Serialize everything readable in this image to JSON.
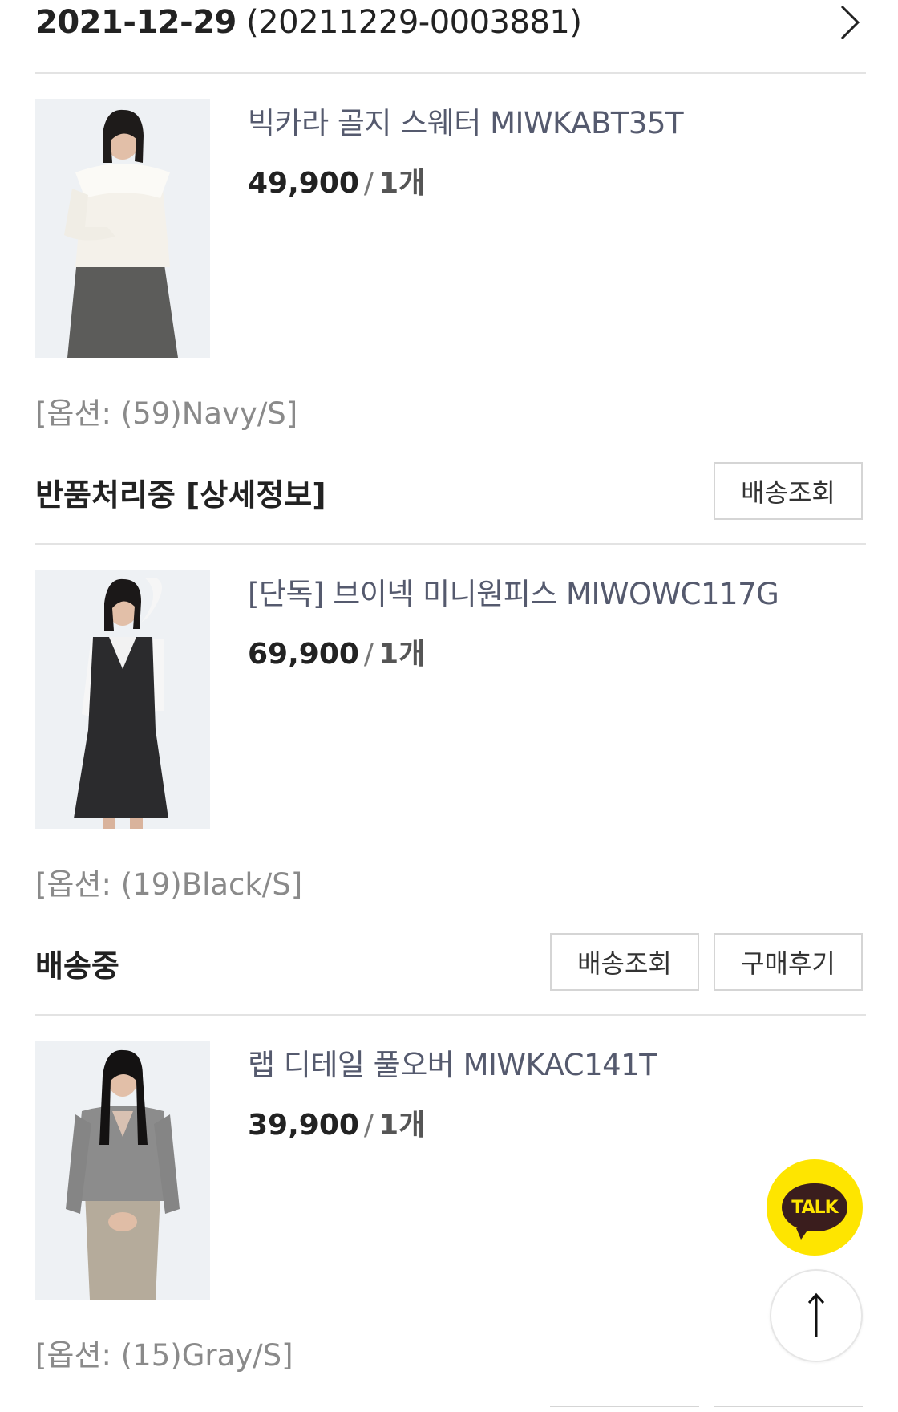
{
  "order": {
    "date": "2021-12-29",
    "number": "(20211229-0003881)"
  },
  "items": [
    {
      "name": "빅카라 골지 스웨터 MIWKABT35T",
      "price": "49,900",
      "separator": "/",
      "quantity": "1개",
      "option": "[옵션: (59)Navy/S]",
      "status": "반품처리중 [상세정보]",
      "buttons": [
        "배송조회"
      ]
    },
    {
      "name": "[단독] 브이넥 미니원피스 MIWOWC117G",
      "price": "69,900",
      "separator": "/",
      "quantity": "1개",
      "option": "[옵션: (19)Black/S]",
      "status": "배송중",
      "buttons": [
        "배송조회",
        "구매후기"
      ]
    },
    {
      "name": "랩 디테일 풀오버 MIWKAC141T",
      "price": "39,900",
      "separator": "/",
      "quantity": "1개",
      "option": "[옵션: (15)Gray/S]"
    }
  ],
  "floating": {
    "talk_label": "TALK",
    "talk_color": "#fee500",
    "top_icon": "arrow-up-icon"
  }
}
